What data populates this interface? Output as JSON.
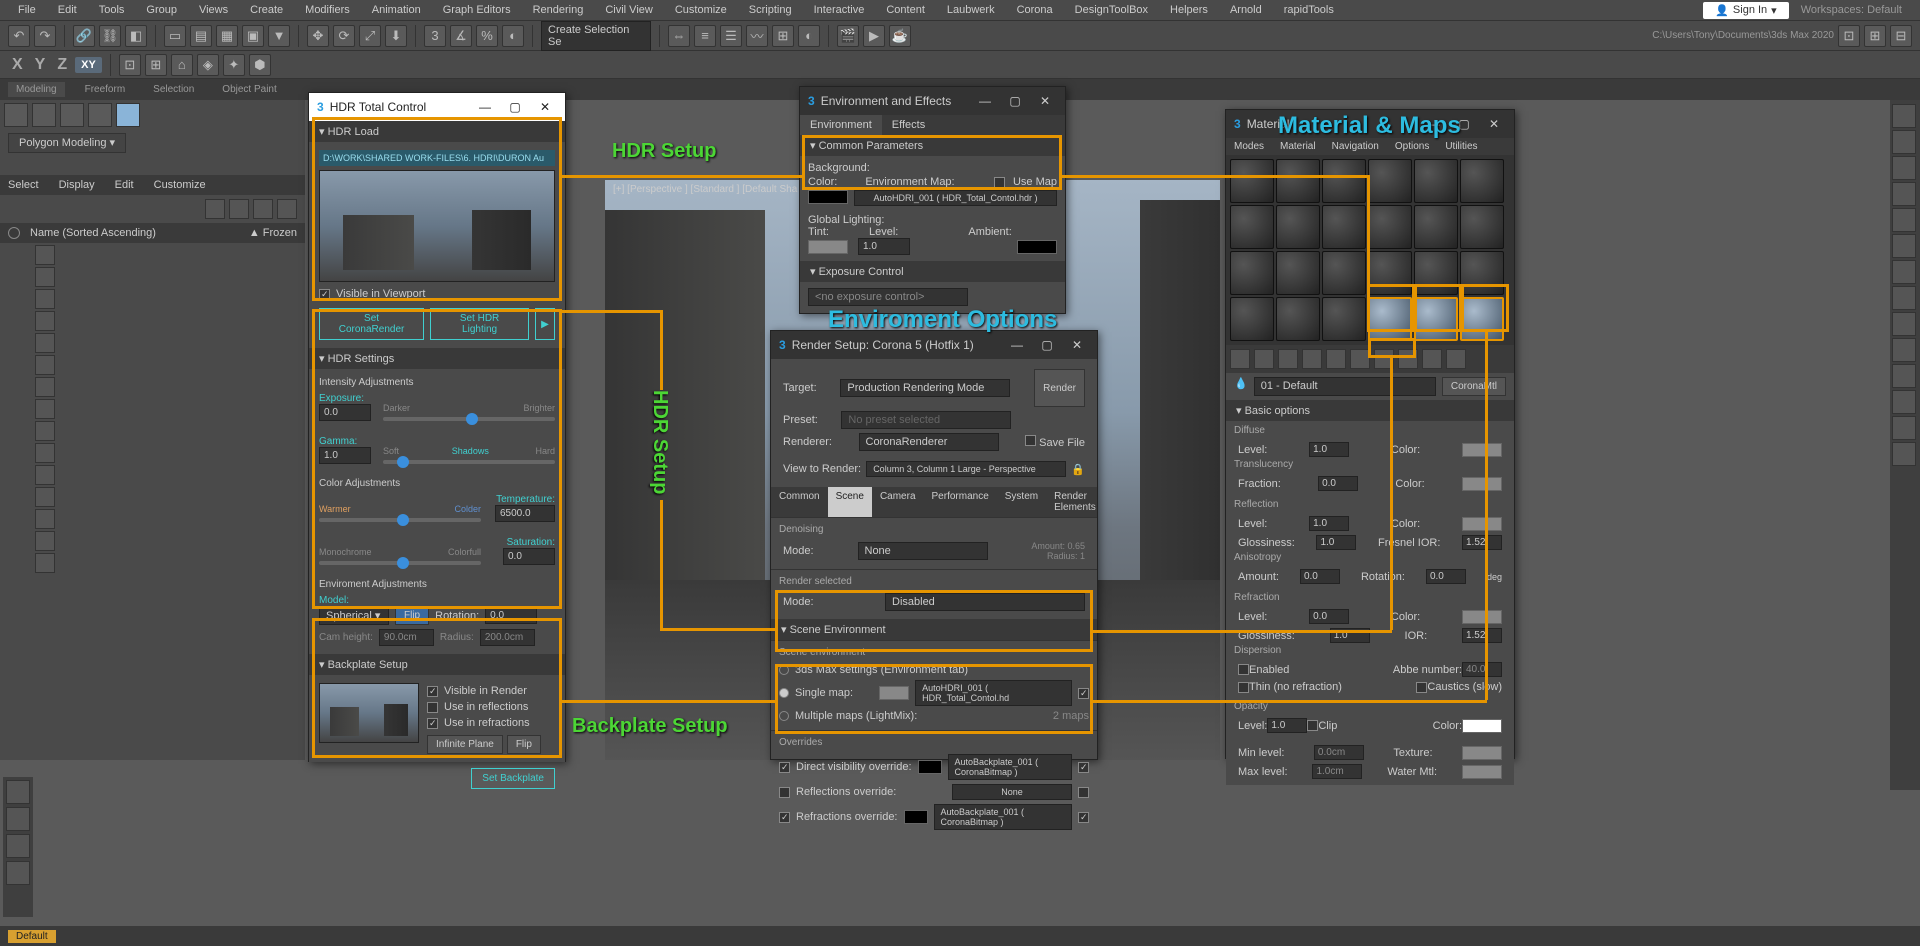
{
  "menu": [
    "File",
    "Edit",
    "Tools",
    "Group",
    "Views",
    "Create",
    "Modifiers",
    "Animation",
    "Graph Editors",
    "Rendering",
    "Civil View",
    "Customize",
    "Scripting",
    "Interactive",
    "Content",
    "Laubwerk",
    "Corona",
    "DesignToolBox",
    "Helpers",
    "Arnold",
    "rapidTools"
  ],
  "signIn": "Sign In",
  "workspacesLabel": "Workspaces: Default",
  "selectionSet": "Create Selection Se",
  "docPath": "C:\\Users\\Tony\\Documents\\3ds Max 2020",
  "axis": {
    "x": "X",
    "y": "Y",
    "z": "Z",
    "xy": "XY"
  },
  "wsTabs": [
    "Modeling",
    "Freeform",
    "Selection",
    "Object Paint"
  ],
  "polyDropdown": "Polygon Modeling  ▾",
  "sceneEx": {
    "cols": [
      "Select",
      "Display",
      "Edit",
      "Customize"
    ],
    "name": "Name (Sorted Ascending)",
    "frozen": "▲ Frozen"
  },
  "viewport": {
    "info": "[+] [Perspective ] [Standard ] [Default Sha"
  },
  "hdr": {
    "title": "HDR Total Control",
    "rollLoad": "HDR Load",
    "pathField": "D:\\WORK\\SHARED WORK-FILES\\6. HDRI\\DURON Au",
    "visible": "Visible in Viewport",
    "btnCorona": "Set CoronaRender",
    "btnLighting": "Set HDR Lighting",
    "rollSettings": "HDR Settings",
    "intAdj": "Intensity Adjustments",
    "exposure": "Exposure:",
    "expVal": "0.0",
    "darker": "Darker",
    "brighter": "Brighter",
    "gamma": "Gamma:",
    "gamVal": "1.0",
    "soft": "Soft",
    "shadows": "Shadows",
    "hard": "Hard",
    "colorAdj": "Color Adjustments",
    "warmer": "Warmer",
    "colder": "Colder",
    "temperature": "Temperature:",
    "tempVal": "6500.0",
    "mono": "Monochrome",
    "colorful": "Colorfull",
    "saturation": "Saturation:",
    "satVal": "0.0",
    "envAdj": "Enviroment Adjustments",
    "model": "Model:",
    "spherical": "Spherical  ▾",
    "flip": "Flip",
    "rotation": "Rotation:",
    "rotVal": "0.0",
    "camH": "Cam height:",
    "camHVal": "90.0cm",
    "radius": "Radius:",
    "radVal": "200.0cm",
    "rollBackplate": "Backplate Setup",
    "visRender": "Visible in Render",
    "useRefl": "Use in reflections",
    "useRefr": "Use in refractions",
    "infPlane": "Infinite Plane",
    "btnSetBack": "Set Backplate"
  },
  "env": {
    "title": "Environment and Effects",
    "tabEnv": "Environment",
    "tabFx": "Effects",
    "common": "Common Parameters",
    "background": "Background:",
    "color": "Color:",
    "envMap": "Environment Map:",
    "useMap": "Use Map",
    "mapText": "AutoHDRI_001 ( HDR_Total_Contol.hdr )",
    "global": "Global Lighting:",
    "tint": "Tint:",
    "level": "Level:",
    "levelVal": "1.0",
    "ambient": "Ambient:",
    "exposure": "Exposure Control",
    "noExp": "<no exposure control>"
  },
  "rsc": {
    "title": "Render Setup: Corona 5 (Hotfix 1)",
    "target": "Target:",
    "targetVal": "Production Rendering Mode",
    "preset": "Preset:",
    "presetVal": "No preset selected",
    "render": "Render",
    "renderer": "Renderer:",
    "rendererVal": "CoronaRenderer",
    "saveFile": "Save File",
    "viewToRender": "View to Render:",
    "viewVal": "Column 3, Column 1 Large - Perspective",
    "tabs": [
      "Common",
      "Scene",
      "Camera",
      "Performance",
      "System",
      "Render Elements"
    ],
    "denoising": "Denoising",
    "mode": "Mode:",
    "none": "None",
    "amount": "Amount:",
    "amountVal": "0.65",
    "radius": "Radius:",
    "radiusVal": "1",
    "renderSel": "Render selected",
    "disabled": "Disabled",
    "sceneEnv": "Scene Environment",
    "sceneEnvLbl": "Scene environment",
    "opt1": "3ds Max settings (Environment tab)",
    "opt2": "Single map:",
    "opt2Val": "AutoHDRI_001 ( HDR_Total_Contol.hd",
    "opt3": "Multiple maps (LightMix):",
    "opt3Val": "2 maps",
    "overrides": "Overrides",
    "dirVis": "Direct visibility override:",
    "dirVisVal": "AutoBackplate_001 ( CoronaBitmap )",
    "reflOv": "Reflections override:",
    "reflOvVal": "None",
    "refrOv": "Refractions override:",
    "refrOvVal": "AutoBackplate_001 ( CoronaBitmap )"
  },
  "mat": {
    "title": "Material",
    "menu": [
      "Modes",
      "Material",
      "Navigation",
      "Options",
      "Utilities"
    ],
    "slotName": "01 - Default",
    "slotType": "CoronaMtl",
    "basic": "Basic options",
    "diffuse": "Diffuse",
    "level": "Level:",
    "l1": "1.0",
    "color": "Color:",
    "trans": "Translucency",
    "fraction": "Fraction:",
    "f0": "0.0",
    "reflection": "Reflection",
    "gloss": "Glossiness:",
    "fresnel": "Fresnel IOR:",
    "ior": "1.52",
    "aniso": "Anisotropy",
    "amount": "Amount:",
    "rotation": "Rotation:",
    "deg": "deg",
    "refraction": "Refraction",
    "disp": "Dispersion",
    "enabled": "Enabled",
    "abbe": "Abbe number:",
    "abbeVal": "40.0",
    "thin": "Thin (no refraction)",
    "caustics": "Caustics (slow)",
    "opacity": "Opacity",
    "clip": "Clip",
    "minLevel": "Min level:",
    "minVal": "0.0cm",
    "texture": "Texture:",
    "maxLevel": "Max level:",
    "maxVal": "1.0cm",
    "waterM": "Water Mtl:"
  },
  "statusbar": "Default",
  "annotations": {
    "hdrSetup": "HDR Setup",
    "envOptions": "Enviroment Options",
    "matMaps": "Material & Maps",
    "backplate": "Backplate Setup",
    "hdrSetupV": "HDR Setup"
  }
}
